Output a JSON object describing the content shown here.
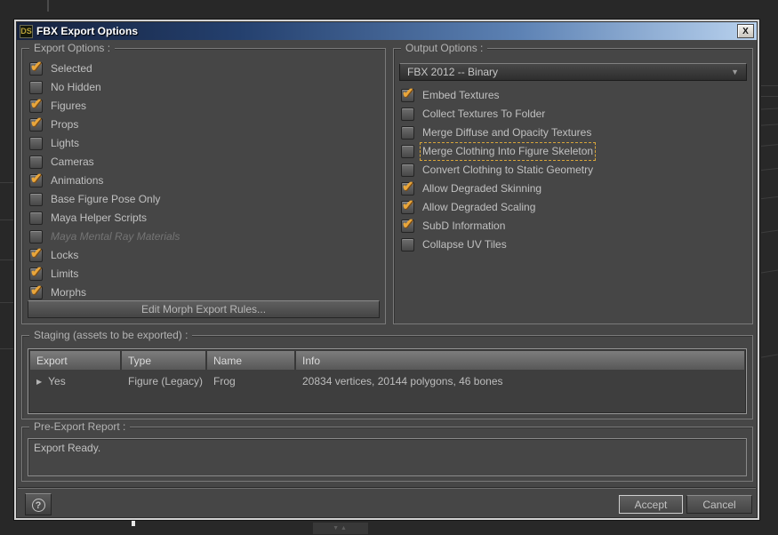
{
  "window": {
    "icon_text": "DS",
    "title": "FBX Export Options"
  },
  "icons": {
    "close": "X",
    "check": "✔",
    "dropdown_arrow": "▼",
    "expand_row": "▶",
    "help": "?",
    "collapse_handle": "▼▲"
  },
  "export_options": {
    "legend": "Export Options :",
    "items": [
      {
        "label": "Selected",
        "checked": true
      },
      {
        "label": "No Hidden",
        "checked": false
      },
      {
        "label": "Figures",
        "checked": true
      },
      {
        "label": "Props",
        "checked": true
      },
      {
        "label": "Lights",
        "checked": false
      },
      {
        "label": "Cameras",
        "checked": false
      },
      {
        "label": "Animations",
        "checked": true
      },
      {
        "label": "Base Figure Pose Only",
        "checked": false
      },
      {
        "label": "Maya Helper Scripts",
        "checked": false
      },
      {
        "label": "Maya Mental Ray Materials",
        "checked": false,
        "disabled": true
      },
      {
        "label": "Locks",
        "checked": true
      },
      {
        "label": "Limits",
        "checked": true
      },
      {
        "label": "Morphs",
        "checked": true
      }
    ],
    "edit_morph_button": "Edit Morph Export Rules..."
  },
  "output_options": {
    "legend": "Output Options :",
    "format_dropdown": "FBX 2012 -- Binary",
    "items": [
      {
        "label": "Embed Textures",
        "checked": true
      },
      {
        "label": "Collect Textures To Folder",
        "checked": false
      },
      {
        "label": "Merge Diffuse and Opacity Textures",
        "checked": false
      },
      {
        "label": "Merge Clothing Into Figure Skeleton",
        "checked": false,
        "focused": true
      },
      {
        "label": "Convert Clothing to Static Geometry",
        "checked": false
      },
      {
        "label": "Allow Degraded Skinning",
        "checked": true
      },
      {
        "label": "Allow Degraded Scaling",
        "checked": true
      },
      {
        "label": "SubD Information",
        "checked": true
      },
      {
        "label": "Collapse UV Tiles",
        "checked": false
      }
    ]
  },
  "staging": {
    "legend": "Staging (assets to be exported) :",
    "columns": [
      "Export",
      "Type",
      "Name",
      "Info"
    ],
    "rows": [
      {
        "export": "Yes",
        "type": "Figure (Legacy)",
        "name": "Frog",
        "info": "20834 vertices, 20144 polygons, 46 bones"
      }
    ]
  },
  "pre_export_report": {
    "legend": "Pre-Export Report :",
    "text": "Export Ready."
  },
  "footer": {
    "accept_label": "Accept",
    "cancel_label": "Cancel"
  },
  "colors": {
    "check_accent": "#e9a63b",
    "focus_dash": "#d8a53a",
    "titlebar_dark": "#16223e",
    "titlebar_light": "#b9d2ee",
    "dialog_bg": "#464646",
    "viewport_bg": "#282828"
  }
}
